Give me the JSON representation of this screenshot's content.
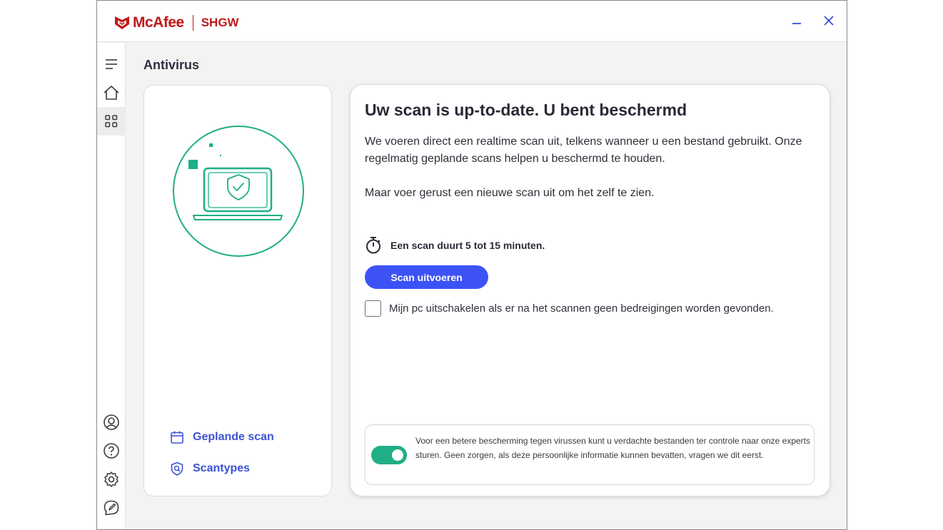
{
  "app": {
    "brand": "McAfee",
    "subtitle": "SHGW"
  },
  "colors": {
    "brand_red": "#c01818",
    "accent_blue": "#3d52f5",
    "link_blue": "#3d52d5",
    "teal": "#1fae86"
  },
  "window_controls": {
    "minimize_icon": "minimize-icon",
    "close_icon": "close-icon"
  },
  "sidebar": {
    "items": [
      {
        "icon": "menu-icon",
        "active": false
      },
      {
        "icon": "home-icon",
        "active": false
      },
      {
        "icon": "grid-icon",
        "active": true
      }
    ],
    "bottom_items": [
      {
        "icon": "account-icon"
      },
      {
        "icon": "help-icon"
      },
      {
        "icon": "settings-icon"
      },
      {
        "icon": "feedback-icon"
      }
    ]
  },
  "page": {
    "title": "Antivirus"
  },
  "left_panel": {
    "illustration": "laptop-shield-illustration",
    "links": [
      {
        "label": "Geplande scan",
        "icon": "calendar-icon"
      },
      {
        "label": "Scantypes",
        "icon": "shield-scan-icon"
      }
    ]
  },
  "main": {
    "headline": "Uw scan is up-to-date. U bent beschermd",
    "description": "We voeren direct een realtime scan uit, telkens wanneer u een bestand gebruikt. Onze regelmatig geplande scans helpen u beschermd te houden.",
    "description2": "Maar voer gerust een nieuwe scan uit om het zelf te zien.",
    "duration_text": "Een scan duurt 5 tot 15 minuten.",
    "scan_button": "Scan uitvoeren",
    "shutdown_checkbox": {
      "label": "Mijn pc uitschakelen als er na het scannen geen bedreigingen worden gevonden.",
      "checked": false
    },
    "info": {
      "text": "Voor een betere bescherming tegen virussen kunt u verdachte bestanden ter controle naar onze experts sturen. Geen zorgen, als deze persoonlijke informatie kunnen bevatten, vragen we dit eerst.",
      "toggle_on": true
    }
  }
}
